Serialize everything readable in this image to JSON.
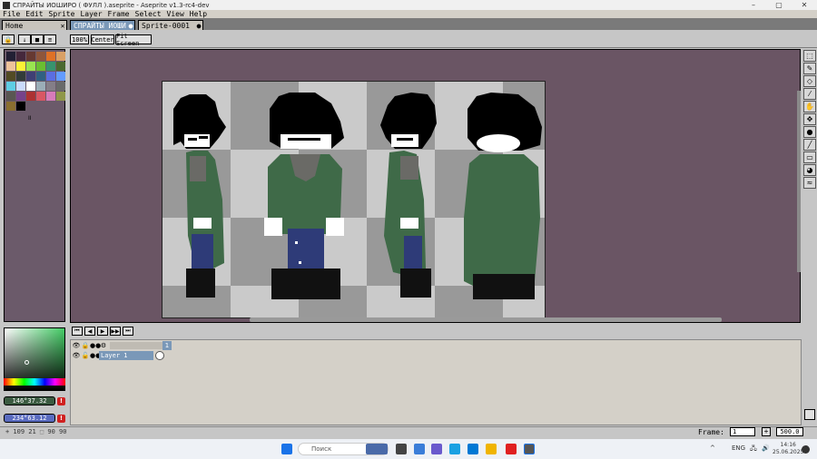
{
  "window": {
    "title": "СПРАЙТЫ ИОШИРО ( ФУЛЛ ).aseprite - Aseprite v1.3-rc4-dev",
    "controls": [
      "–",
      "▢",
      "✕"
    ]
  },
  "menu": [
    "File",
    "Edit",
    "Sprite",
    "Layer",
    "Frame",
    "Select",
    "View",
    "Help"
  ],
  "tabs": [
    {
      "label": "Home",
      "close": "✕"
    },
    {
      "label": "СПРАЙТЫ ИОШИ",
      "close": "●"
    },
    {
      "label": "Sprite-0001",
      "close": "●"
    }
  ],
  "context": {
    "zoom_100": "100%",
    "center": "Center",
    "fit_screen": "Fit Screen"
  },
  "palette": {
    "colors": [
      "#222034",
      "#45283c",
      "#663931",
      "#8f563b",
      "#df7126",
      "#d9a066",
      "#eec39a",
      "#fbf236",
      "#99e550",
      "#6abe30",
      "#37946e",
      "#4b692f",
      "#524b24",
      "#323c39",
      "#3f3f74",
      "#306082",
      "#5b6ee1",
      "#639bff",
      "#5fcde4",
      "#cbdbfc",
      "#ffffff",
      "#9badb7",
      "#847e87",
      "#696a6a",
      "#595652",
      "#76428a",
      "#ac3232",
      "#d95763",
      "#d77bba",
      "#8f974a",
      "#8a6f30",
      "#000000"
    ],
    "index_label": "II"
  },
  "colors": {
    "foreground": "146°37.32",
    "background": "234°63.12",
    "fg_color": "#3a5a40",
    "bg_color": "#5a6cc0"
  },
  "timeline": {
    "layer_name": "Layer 1",
    "frame_number": "1"
  },
  "status": {
    "coords": "+  109  21  ⬚  90  90",
    "frame_label": "Frame:",
    "frame_value": "1",
    "zoom": "500.0"
  },
  "taskbar": {
    "search_placeholder": "Поиск",
    "lang": "ENG",
    "time": "14:16",
    "date": "25.06.2025"
  }
}
